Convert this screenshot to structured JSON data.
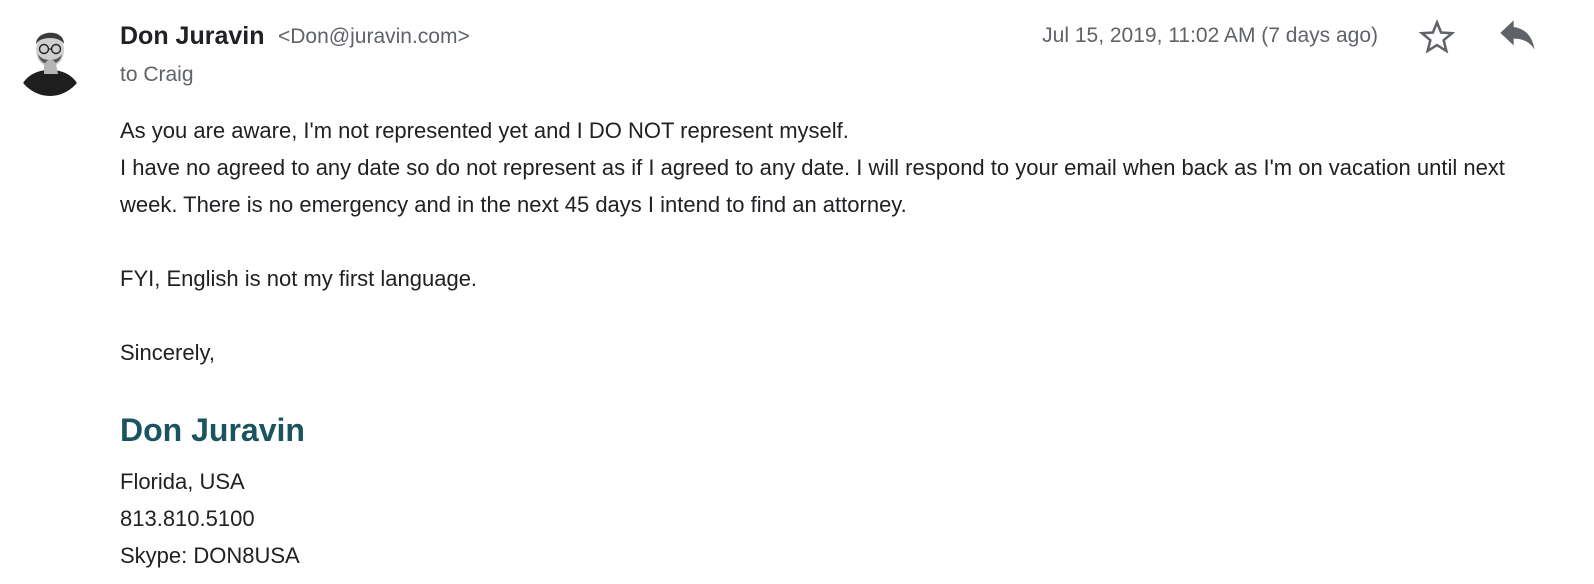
{
  "header": {
    "sender_name": "Don Juravin",
    "sender_email": "<Don@juravin.com>",
    "recipient": "to Craig",
    "timestamp": "Jul 15, 2019, 11:02 AM (7 days ago)",
    "star_icon": "star-outline-icon",
    "reply_icon": "reply-arrow-icon"
  },
  "body": {
    "paragraph1_line1": "As you are aware, I'm not represented yet and I DO NOT represent myself.",
    "paragraph1_line2": "I have no agreed to any date so do not represent as if I agreed to any date. I will respond to your email when back as I'm on vacation until next week. There is no emergency and in the next 45 days I intend to find an attorney.",
    "paragraph2": "FYI, English is not my first language.",
    "closing": "Sincerely,"
  },
  "signature": {
    "name": "Don Juravin",
    "location": "Florida, USA",
    "phone": "813.810.5100",
    "skype": "Skype: DON8USA",
    "name_color": "#1a5460"
  }
}
